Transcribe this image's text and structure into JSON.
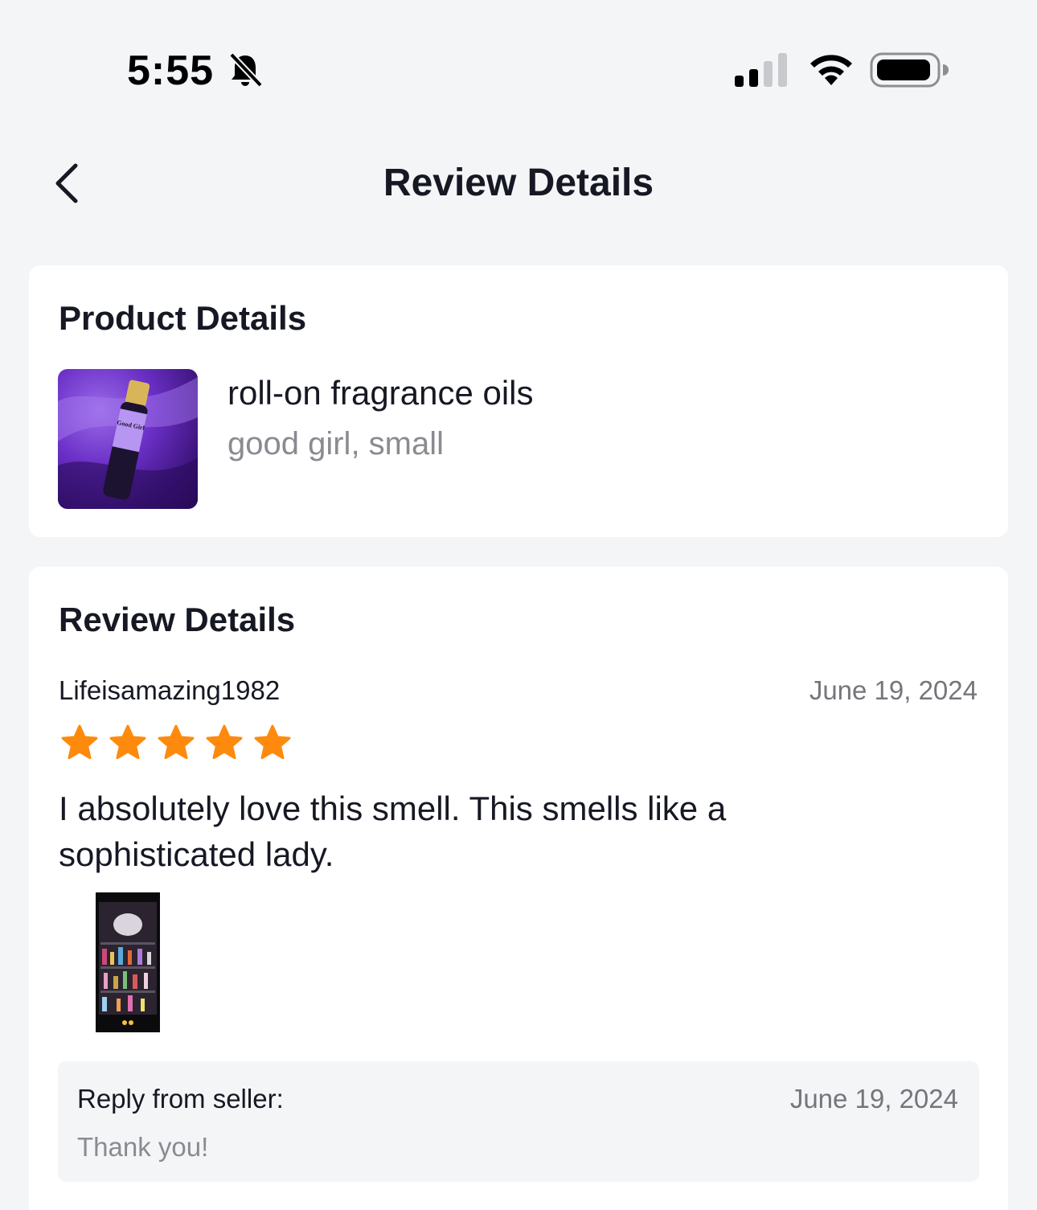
{
  "status_bar": {
    "time": "5:55",
    "icons": [
      "bell-slash-icon",
      "signal-icon",
      "wifi-icon",
      "battery-icon"
    ]
  },
  "nav": {
    "title": "Review Details",
    "back_icon": "chevron-left-icon"
  },
  "product_card": {
    "title": "Product Details",
    "product_name": "roll-on fragrance oils",
    "variant": "good girl, small",
    "image_label": "Good Girl"
  },
  "review_card": {
    "title": "Review Details",
    "reviewer": "Lifeisamazing1982",
    "date": "June 19, 2024",
    "rating": 5,
    "rating_max": 5,
    "text": "I absolutely love this smell. This smells like a sophisticated lady.",
    "reply": {
      "label": "Reply from seller:",
      "date": "June 19, 2024",
      "text": "Thank you!"
    }
  },
  "colors": {
    "background": "#f4f5f7",
    "card": "#ffffff",
    "star": "#fe8a0d",
    "text_primary": "#161823",
    "text_secondary": "#8a8b91"
  }
}
